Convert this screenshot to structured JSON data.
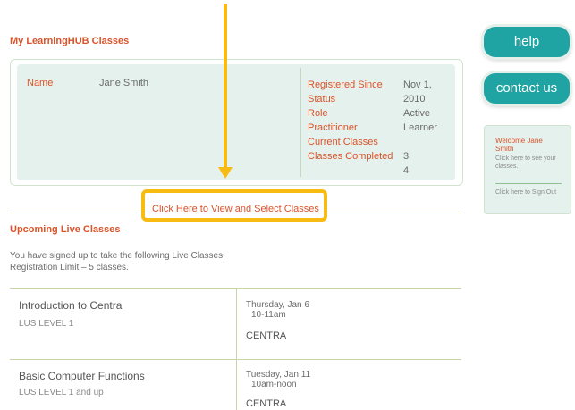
{
  "page": {
    "title": "My LearningHUB Classes"
  },
  "profile": {
    "name_label": "Name",
    "name_value": "Jane Smith",
    "right_labels": [
      "Registered Since",
      "Status",
      "Role",
      "Practitioner",
      "Current Classes",
      "Classes Completed"
    ],
    "right_values": [
      "Nov 1, 2010",
      "Active",
      "Learner",
      "",
      "3",
      "4"
    ]
  },
  "select_link": "Click Here to View and Select Classes",
  "upcoming": {
    "title": "Upcoming Live Classes",
    "intro_line1": "You have signed up to take the following Live Classes:",
    "intro_line2": "Registration Limit – 5 classes.",
    "classes": [
      {
        "title": "Introduction to Centra",
        "level": "LUS LEVEL 1",
        "date": "Thursday, Jan 6",
        "time": "10-11am",
        "type": "CENTRA"
      },
      {
        "title": "Basic Computer Functions",
        "level": "LUS LEVEL 1 and up",
        "date": "Tuesday, Jan 11",
        "time": "10am-noon",
        "type": "CENTRA"
      }
    ]
  },
  "sidebar": {
    "help_label": "help",
    "contact_label": "contact us",
    "welcome_title": "Welcome Jane Smith",
    "welcome_sub": "Click here to see your classes.",
    "sign_out": "Click here to Sign Out"
  },
  "colors": {
    "accent": "#d9532b",
    "teal": "#1fa3a3",
    "highlight": "#f7bb11",
    "panel": "#e5f1ec"
  }
}
